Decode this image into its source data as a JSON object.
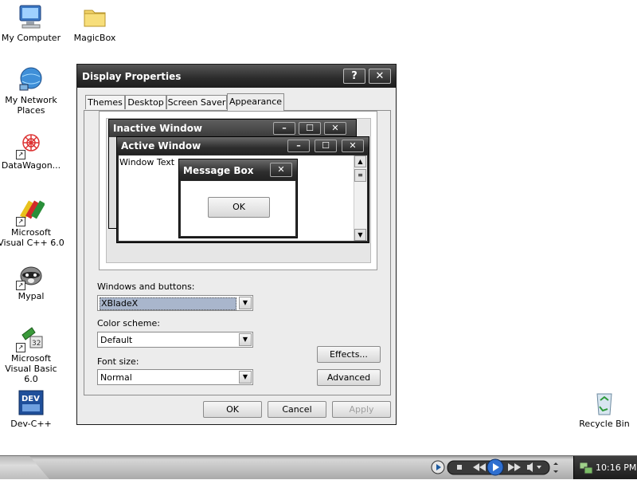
{
  "desktop": {
    "icons": [
      {
        "label": "My Computer"
      },
      {
        "label": "MagicBox"
      },
      {
        "label": "My Network Places"
      },
      {
        "label": "DataWagon..."
      },
      {
        "label": "Microsoft Visual C++ 6.0"
      },
      {
        "label": "Mypal"
      },
      {
        "label": "Microsoft Visual Basic 6.0"
      },
      {
        "label": "Dev-C++"
      },
      {
        "label": "Recycle Bin"
      }
    ],
    "dev_icon_text": "DEV"
  },
  "dialog": {
    "title": "Display Properties",
    "help_label": "?",
    "close_label": "✕",
    "tabs": [
      {
        "label": "Themes"
      },
      {
        "label": "Desktop"
      },
      {
        "label": "Screen Saver"
      },
      {
        "label": "Appearance",
        "active": true
      }
    ],
    "preview": {
      "inactive_title": "Inactive Window",
      "active_title": "Active Window",
      "window_text": "Window Text",
      "message_box_title": "Message Box",
      "ok_label": "OK"
    },
    "windows_and_buttons": {
      "label": "Windows and buttons:",
      "value": "XBladeX"
    },
    "color_scheme": {
      "label": "Color scheme:",
      "value": "Default"
    },
    "font_size": {
      "label": "Font size:",
      "value": "Normal"
    },
    "effects_label": "Effects...",
    "advanced_label": "Advanced",
    "ok_label": "OK",
    "cancel_label": "Cancel",
    "apply_label": "Apply"
  },
  "taskbar": {
    "clock": "10:16 PM"
  },
  "colors": {
    "titlebar": "#2b2b2b",
    "selection": "#a9b6cc",
    "dialog_bg": "#ececec"
  }
}
